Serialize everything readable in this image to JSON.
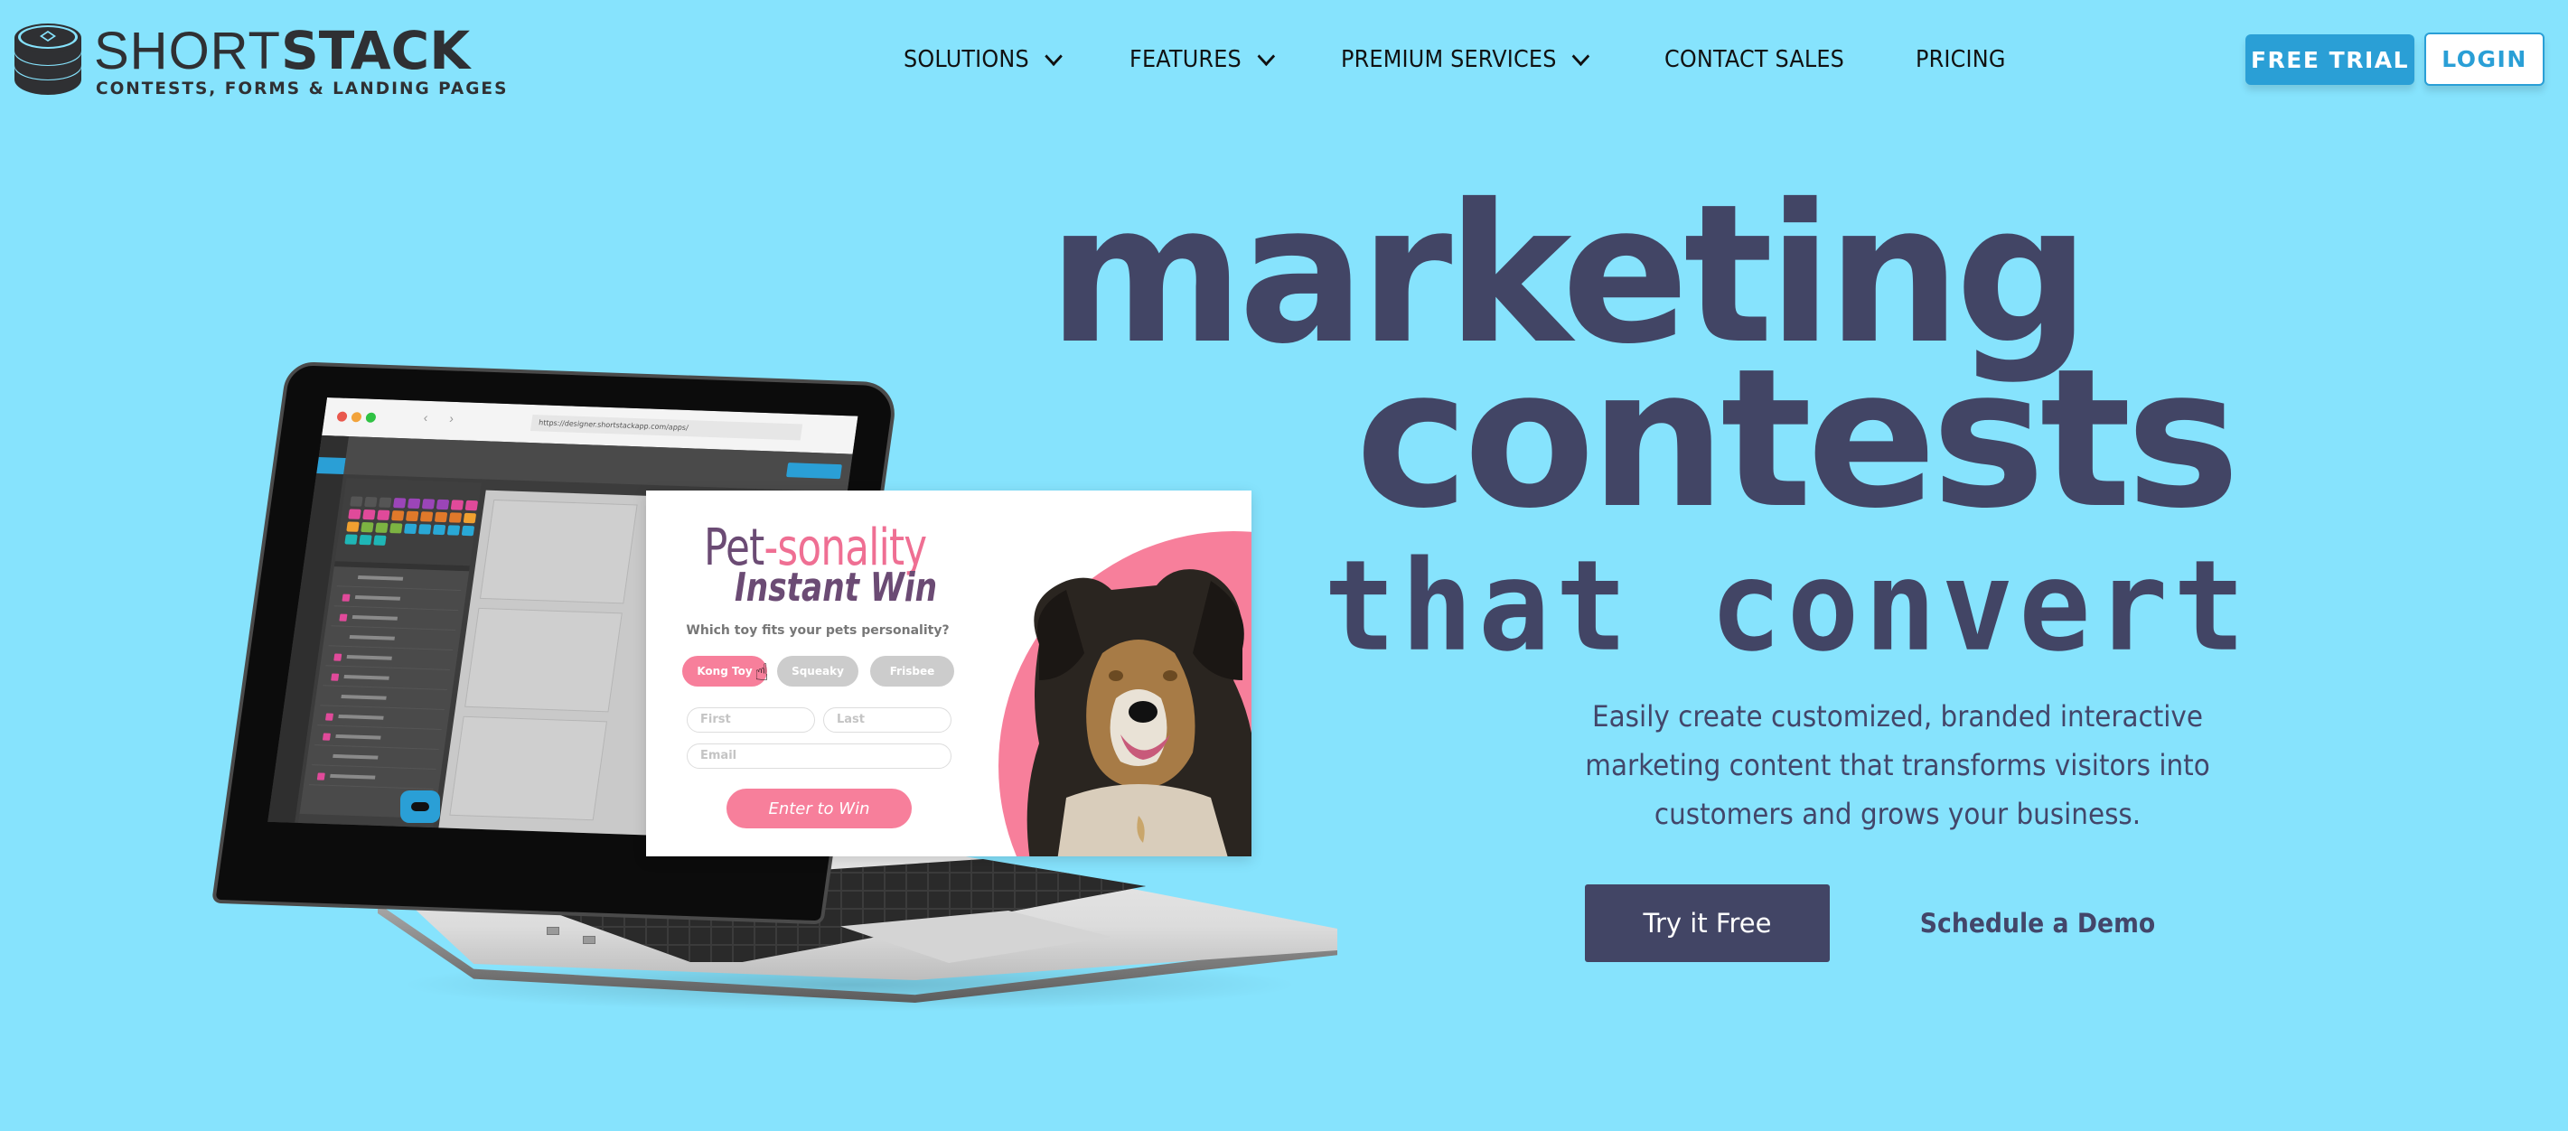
{
  "brand": {
    "name_light": "SHORT",
    "name_bold": "STACK",
    "tagline": "CONTESTS, FORMS & LANDING PAGES",
    "logo_icon": "stacked-coins-icon"
  },
  "nav": {
    "items": [
      {
        "label": "SOLUTIONS",
        "has_dropdown": true
      },
      {
        "label": "FEATURES",
        "has_dropdown": true
      },
      {
        "label": "PREMIUM SERVICES",
        "has_dropdown": true
      },
      {
        "label": "CONTACT SALES",
        "has_dropdown": false
      },
      {
        "label": "PRICING",
        "has_dropdown": false
      }
    ],
    "free_trial_label": "FREE TRIAL",
    "login_label": "LOGIN"
  },
  "hero": {
    "line1": "marketing",
    "line2": "contests",
    "line3": "that convert",
    "description": "Easily create customized, branded interactive marketing content that transforms visitors into customers and grows your business.",
    "primary_cta": "Try it Free",
    "secondary_cta": "Schedule a Demo"
  },
  "laptop_screen": {
    "url": "https://designer.shortstackapp.com/apps/",
    "nav_arrows": "‹ ›"
  },
  "contest_card": {
    "title_part1": "Pet",
    "title_part2": "-sonality",
    "subtitle": "Instant Win",
    "question": "Which toy fits your pets personality?",
    "options": [
      {
        "label": "Kong Toy",
        "selected": true
      },
      {
        "label": "Squeaky",
        "selected": false
      },
      {
        "label": "Frisbee",
        "selected": false
      }
    ],
    "fields": {
      "first_placeholder": "First",
      "last_placeholder": "Last",
      "email_placeholder": "Email"
    },
    "submit_label": "Enter to Win"
  },
  "colors": {
    "background": "#86e3fd",
    "headline": "#424565",
    "accent_blue": "#2a9fd6",
    "accent_pink": "#f77f9b",
    "card_purple": "#6b4b74"
  }
}
